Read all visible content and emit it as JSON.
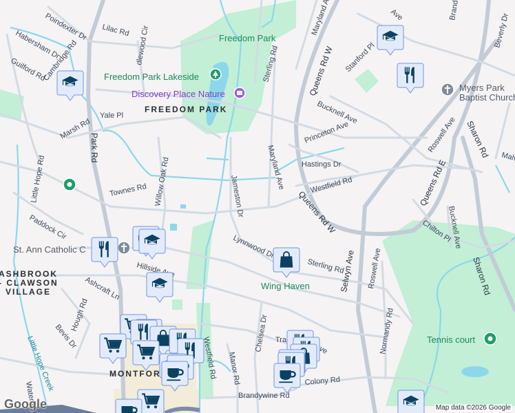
{
  "map": {
    "parks": [
      {
        "name": "Freedom Park"
      },
      {
        "name": "Freedom Park Lakeside"
      },
      {
        "name": "Wing Haven"
      },
      {
        "name": "Tennis court"
      }
    ],
    "places": {
      "discovery": "Discovery Place Nature",
      "church1": "Myers Park",
      "church1b": "Baptist Church",
      "church2": "St. Ann Catholic C"
    },
    "neighborhoods": {
      "freedom_park": "FREEDOM PARK",
      "ashbrook1": "ASHBROOK",
      "ashbrook2": "- CLAWSON",
      "ashbrook3": "VILLAGE",
      "montford": "MONTFORD"
    },
    "streets": [
      "Poindexter Dr",
      "Lilac Rd",
      "Habersham Dr",
      "dlewood Cir",
      "Guilford Rd",
      "Cambridge Rd",
      "Yale Pl",
      "Marsh Rd",
      "Park Rd",
      "Little Hope Rd",
      "Townes Rd",
      "Willow Oak Rd",
      "Jameston Dr",
      "Maryland Ave",
      "Sterling Rd",
      "Queens Rd W",
      "Stanford Pl",
      "Bucknell Ave",
      "Princeton Ave",
      "Hastings Dr",
      "Westfield Rd",
      "Sharon Rd",
      "Queens Rd E",
      "Roswell Ave",
      "Malv",
      "Maryland Ave",
      "Queens Rd W",
      "Selwyn Ave",
      "Roswell Ave",
      "Chilton Pl",
      "Bucknell Ave",
      "Sharon Rd",
      "Lynnwood Dr",
      "Sterling Rd",
      "Hillside Ave",
      "Normandy Rd",
      "Colony Rd",
      "Brandywine Rd",
      "Manor Rd",
      "Westfield Rd",
      "Chelsea Dr",
      "Paddock Cir",
      "Hillside Ave",
      "Ashcraft Ln",
      "Hough Rd",
      "Bevis Dr",
      "Waterbury",
      "Tra",
      "Ave",
      "Brando",
      "Beverly Dr"
    ],
    "creek": "Little Hope Creek",
    "marker_types": [
      "school",
      "restaurant",
      "grocery",
      "shopping",
      "cafe"
    ],
    "attribution": "Map data ©2026 Google",
    "logo": "Google",
    "colors": {
      "park": "#c2efd6",
      "water": "#8dd7ec",
      "marker_fill": "#e3ebfb",
      "marker_border": "#6f97dd",
      "icon": "#0b4263",
      "green_pin": "#1e9e6a",
      "church_pin": "#7f8d99",
      "purple_pin": "#a05ce0"
    }
  }
}
